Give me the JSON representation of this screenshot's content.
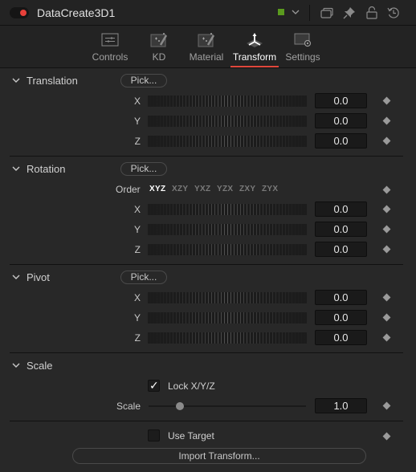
{
  "header": {
    "node_name": "DataCreate3D1",
    "enabled": true,
    "node_color": "#5a9a1e",
    "icons": [
      "toggle-switch",
      "color-swatch",
      "chevron-down-icon",
      "versions-icon",
      "pin-icon",
      "lock-icon",
      "reset-icon"
    ]
  },
  "tabs": [
    {
      "label": "Controls",
      "icon": "sliders-icon",
      "active": false
    },
    {
      "label": "KD",
      "icon": "magic-wand-icon",
      "active": false
    },
    {
      "label": "Material",
      "icon": "magic-wand-icon",
      "active": false
    },
    {
      "label": "Transform",
      "icon": "transform-axes-icon",
      "active": true
    },
    {
      "label": "Settings",
      "icon": "settings-gear-icon",
      "active": false
    }
  ],
  "accent_color": "#e0473c",
  "translation": {
    "title": "Translation",
    "pick_label": "Pick...",
    "x": {
      "label": "X",
      "value": "0.0"
    },
    "y": {
      "label": "Y",
      "value": "0.0"
    },
    "z": {
      "label": "Z",
      "value": "0.0"
    }
  },
  "rotation": {
    "title": "Rotation",
    "pick_label": "Pick...",
    "order_label": "Order",
    "order_options": [
      "XYZ",
      "XZY",
      "YXZ",
      "YZX",
      "ZXY",
      "ZYX"
    ],
    "order_selected": "XYZ",
    "x": {
      "label": "X",
      "value": "0.0"
    },
    "y": {
      "label": "Y",
      "value": "0.0"
    },
    "z": {
      "label": "Z",
      "value": "0.0"
    }
  },
  "pivot": {
    "title": "Pivot",
    "pick_label": "Pick...",
    "x": {
      "label": "X",
      "value": "0.0"
    },
    "y": {
      "label": "Y",
      "value": "0.0"
    },
    "z": {
      "label": "Z",
      "value": "0.0"
    }
  },
  "scale": {
    "title": "Scale",
    "lock_label": "Lock X/Y/Z",
    "lock_checked": true,
    "scale_label": "Scale",
    "scale_value": "1.0",
    "slider_fraction": 0.2
  },
  "use_target": {
    "label": "Use Target",
    "checked": false
  },
  "import_button": "Import Transform..."
}
